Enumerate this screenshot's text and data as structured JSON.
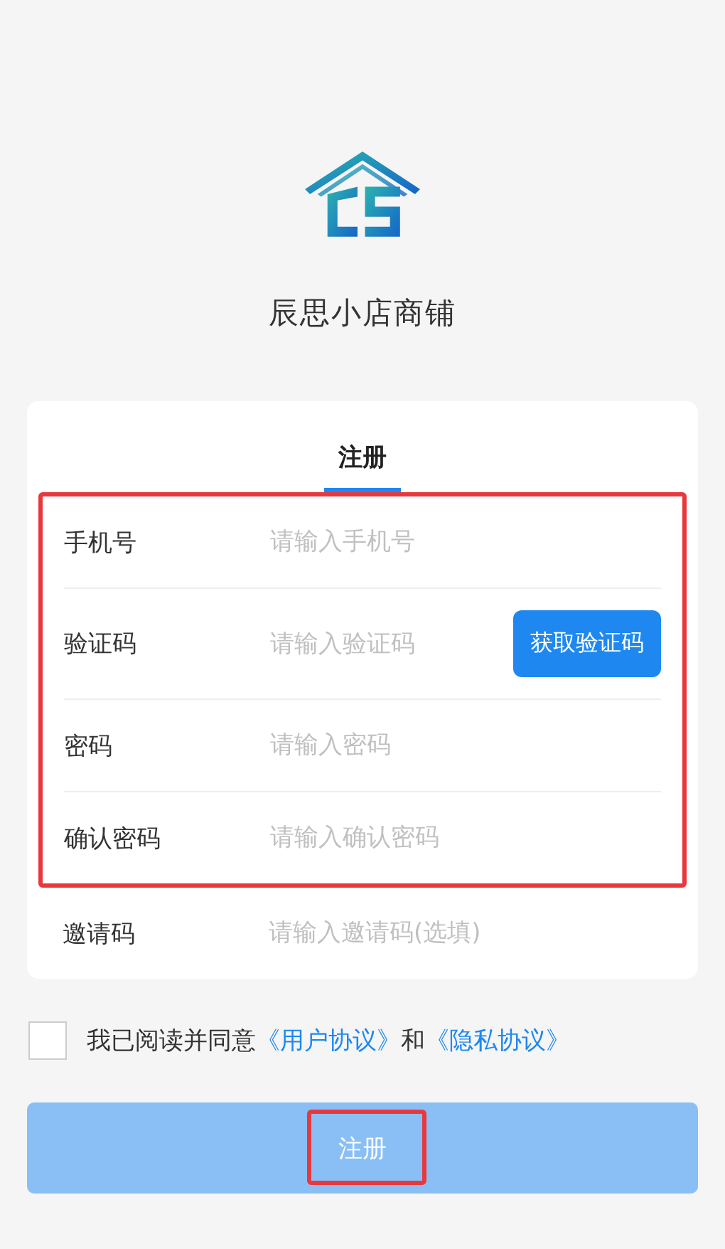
{
  "app": {
    "name": "辰思小店商铺"
  },
  "tabs": [
    {
      "label": "注册",
      "selected": true
    }
  ],
  "fields": [
    {
      "label": "手机号",
      "placeholder": "请输入手机号",
      "highlighted": true
    },
    {
      "label": "验证码",
      "placeholder": "请输入验证码",
      "action": "获取验证码",
      "highlighted": true
    },
    {
      "label": "密码",
      "placeholder": "请输入密码",
      "highlighted": true
    },
    {
      "label": "确认密码",
      "placeholder": "请输入确认密码",
      "highlighted": true
    },
    {
      "label": "邀请码",
      "placeholder": "请输入邀请码(选填)",
      "highlighted": false
    }
  ],
  "agreement": {
    "checked": false,
    "parts": [
      {
        "kind": "text",
        "text": "我已阅读并同意"
      },
      {
        "kind": "link",
        "text": "《用户协议》"
      },
      {
        "kind": "text",
        "text": "和"
      },
      {
        "kind": "link",
        "text": "《隐私协议》"
      }
    ]
  },
  "submit": {
    "label": "注册",
    "disabled": true,
    "highlighted": true
  }
}
